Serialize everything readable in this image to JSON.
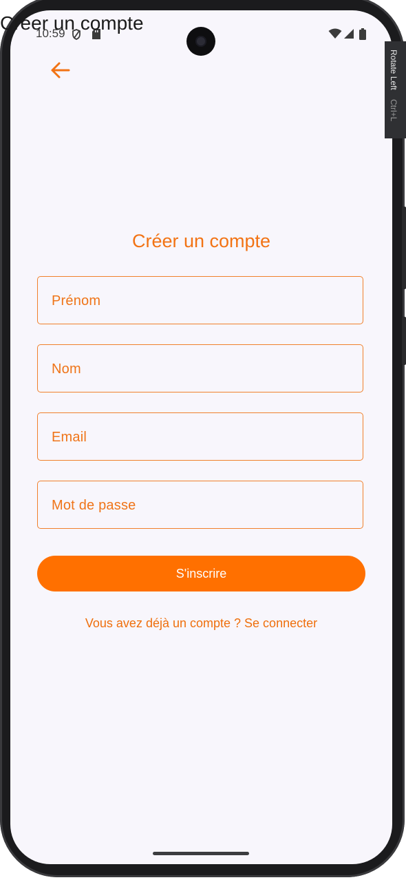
{
  "window": {
    "title": "Créer un compte"
  },
  "status_bar": {
    "time": "10:59"
  },
  "screen": {
    "heading": "Créer un compte",
    "fields": [
      {
        "placeholder": "Prénom"
      },
      {
        "placeholder": "Nom"
      },
      {
        "placeholder": "Email"
      },
      {
        "placeholder": "Mot de passe"
      }
    ],
    "submit_label": "S'inscrire",
    "login_link": "Vous avez déjà un compte ? Se connecter"
  },
  "emulator": {
    "rotate_label": "Rotate Left",
    "rotate_shortcut": "Ctrl+L"
  },
  "colors": {
    "accent": "#ff7000",
    "text_accent": "#f27314",
    "background": "#f8f6fc"
  },
  "icons": {
    "back": "arrow-left-icon",
    "vpn": "vpn-key-icon",
    "sd": "sd-card-icon",
    "wifi": "wifi-icon",
    "signal": "signal-icon",
    "battery": "battery-icon"
  }
}
